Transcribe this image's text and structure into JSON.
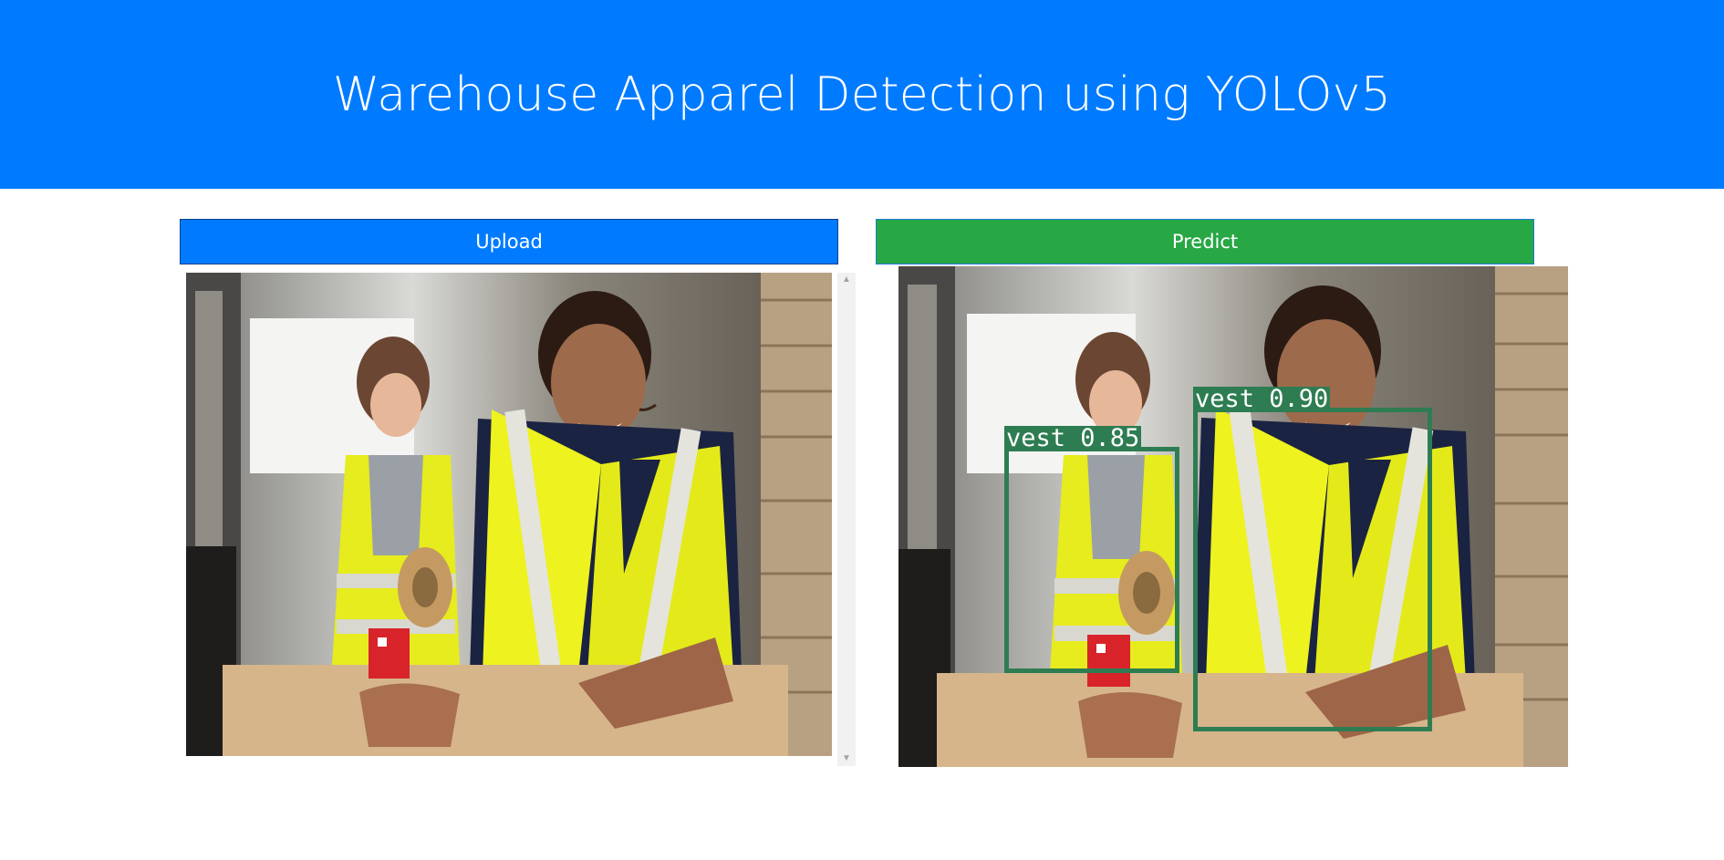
{
  "header": {
    "title": "Warehouse Apparel Detection using YOLOv5"
  },
  "toolbar": {
    "upload_label": "Upload",
    "predict_label": "Predict"
  },
  "colors": {
    "header_bg": "#007bff",
    "upload_button": "#007bff",
    "predict_button": "#28a745",
    "detection_box": "#2e7d52"
  },
  "input_image": {
    "subject": "warehouse-workers-photo"
  },
  "output_image": {
    "detections": [
      {
        "label": "vest 0.85"
      },
      {
        "label": "vest 0.90"
      }
    ]
  }
}
